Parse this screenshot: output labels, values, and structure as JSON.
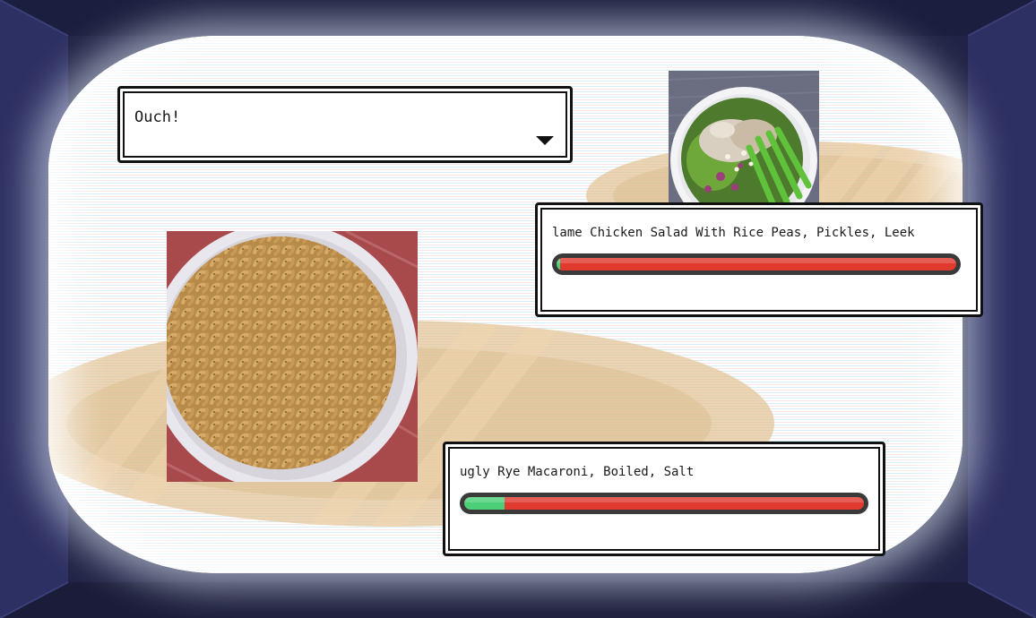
{
  "dialog": {
    "text": "Ouch!",
    "advance_icon": "triangle-down-icon"
  },
  "enemy": {
    "name": "lame Chicken Salad With Rice Peas, Pickles, Leek",
    "hp_fraction": 0.01,
    "sprite": "chicken-salad-bowl"
  },
  "player": {
    "name": "ugly Rye Macaroni, Boiled, Salt",
    "hp_fraction": 0.1,
    "sprite": "macaroni-bowl"
  },
  "colors": {
    "hp_remaining": "#4ccf78",
    "hp_lost": "#e03a2f",
    "hp_track": "#3a3a3a",
    "room_background": "#212346",
    "platform": "#e2c496"
  }
}
